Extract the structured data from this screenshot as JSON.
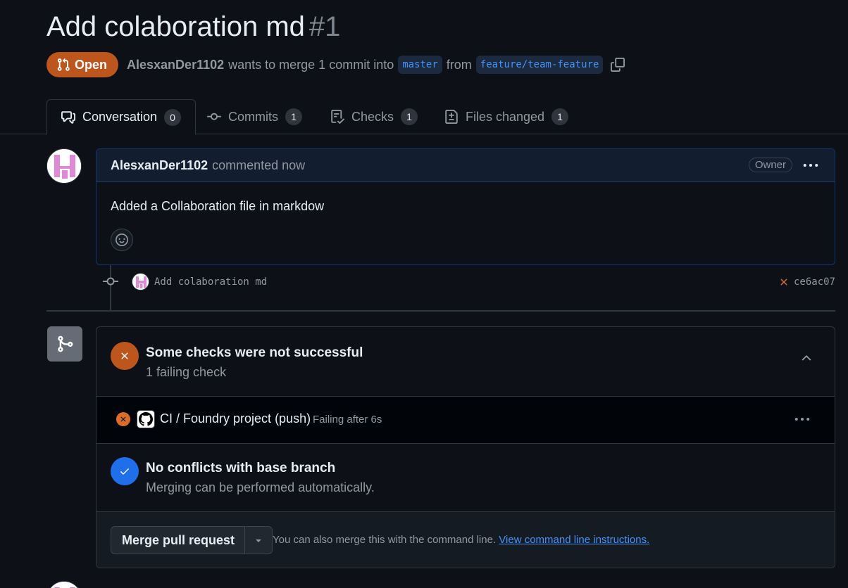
{
  "pr": {
    "title": "Add colaboration md",
    "number": "#1",
    "state": "Open",
    "author": "AlesxanDer1102",
    "merge_text": "wants to merge 1 commit into",
    "base_branch": "master",
    "from_text": "from",
    "head_branch": "feature/team-feature"
  },
  "tabs": [
    {
      "label": "Conversation",
      "count": "0",
      "icon": "comment-discussion-icon"
    },
    {
      "label": "Commits",
      "count": "1",
      "icon": "git-commit-icon"
    },
    {
      "label": "Checks",
      "count": "1",
      "icon": "checklist-icon"
    },
    {
      "label": "Files changed",
      "count": "1",
      "icon": "file-diff-icon"
    }
  ],
  "comment": {
    "author": "AlesxanDer1102",
    "time": "commented now",
    "role": "Owner",
    "body": "Added a Collaboration file in markdow"
  },
  "commit": {
    "message": "Add colaboration md",
    "sha": "ce6ac07",
    "status": "failed"
  },
  "checks": {
    "title": "Some checks were not successful",
    "subtitle": "1 failing check",
    "items": [
      {
        "name": "CI / Foundry project (push)",
        "status": "Failing after 6s"
      }
    ]
  },
  "conflicts": {
    "title": "No conflicts with base branch",
    "subtitle": "Merging can be performed automatically."
  },
  "merge": {
    "button_label": "Merge pull request",
    "hint": "You can also merge this with the command line.",
    "link": "View command line instructions."
  },
  "colors": {
    "background": "#0d1117",
    "open_badge": "#bd561d",
    "fail": "#db6d28",
    "success": "#1f6feb",
    "link": "#4493f8"
  }
}
